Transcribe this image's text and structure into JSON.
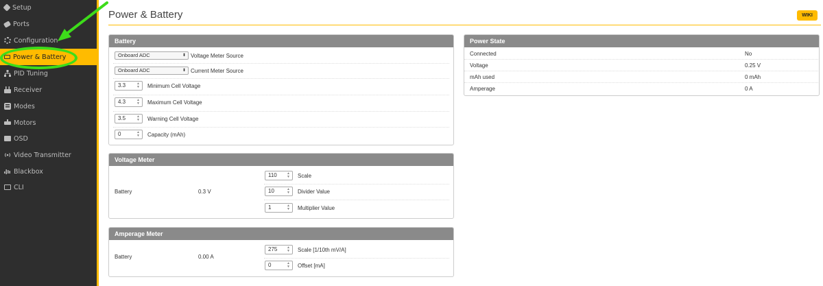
{
  "sidebar": {
    "items": [
      {
        "label": "Setup",
        "icon": "wrench-icon"
      },
      {
        "label": "Ports",
        "icon": "plug-icon"
      },
      {
        "label": "Configuration",
        "icon": "gear-icon"
      },
      {
        "label": "Power & Battery",
        "icon": "battery-icon",
        "active": true
      },
      {
        "label": "PID Tuning",
        "icon": "sitemap-icon"
      },
      {
        "label": "Receiver",
        "icon": "receiver-icon"
      },
      {
        "label": "Modes",
        "icon": "modes-icon"
      },
      {
        "label": "Motors",
        "icon": "motors-icon"
      },
      {
        "label": "OSD",
        "icon": "osd-icon"
      },
      {
        "label": "Video Transmitter",
        "icon": "antenna-icon"
      },
      {
        "label": "Blackbox",
        "icon": "blackbox-icon"
      },
      {
        "label": "CLI",
        "icon": "terminal-icon"
      }
    ]
  },
  "header": {
    "title": "Power & Battery",
    "wiki_label": "WIKI"
  },
  "battery": {
    "title": "Battery",
    "voltage_source": {
      "value": "Onboard ADC",
      "label": "Voltage Meter Source"
    },
    "current_source": {
      "value": "Onboard ADC",
      "label": "Current Meter Source"
    },
    "min_cell": {
      "value": "3.3",
      "label": "Minimum Cell Voltage"
    },
    "max_cell": {
      "value": "4.3",
      "label": "Maximum Cell Voltage"
    },
    "warn_cell": {
      "value": "3.5",
      "label": "Warning Cell Voltage"
    },
    "capacity": {
      "value": "0",
      "label": "Capacity (mAh)"
    }
  },
  "voltage_meter": {
    "title": "Voltage Meter",
    "name": "Battery",
    "reading": "0.3 V",
    "scale": {
      "value": "110",
      "label": "Scale"
    },
    "divider": {
      "value": "10",
      "label": "Divider Value"
    },
    "multiplier": {
      "value": "1",
      "label": "Multiplier Value"
    }
  },
  "amperage_meter": {
    "title": "Amperage Meter",
    "name": "Battery",
    "reading": "0.00 A",
    "scale": {
      "value": "275",
      "label": "Scale [1/10th mV/A]"
    },
    "offset": {
      "value": "0",
      "label": "Offset [mA]"
    }
  },
  "power_state": {
    "title": "Power State",
    "rows": [
      {
        "label": "Connected",
        "value": "No"
      },
      {
        "label": "Voltage",
        "value": "0.25 V"
      },
      {
        "label": "mAh used",
        "value": "0 mAh"
      },
      {
        "label": "Amperage",
        "value": "0 A"
      }
    ]
  },
  "colors": {
    "accent": "#ffbb00",
    "sidebar_bg": "#2e2e2e",
    "annotation": "#3ddc1a",
    "panel_header": "#8a8a8a"
  }
}
